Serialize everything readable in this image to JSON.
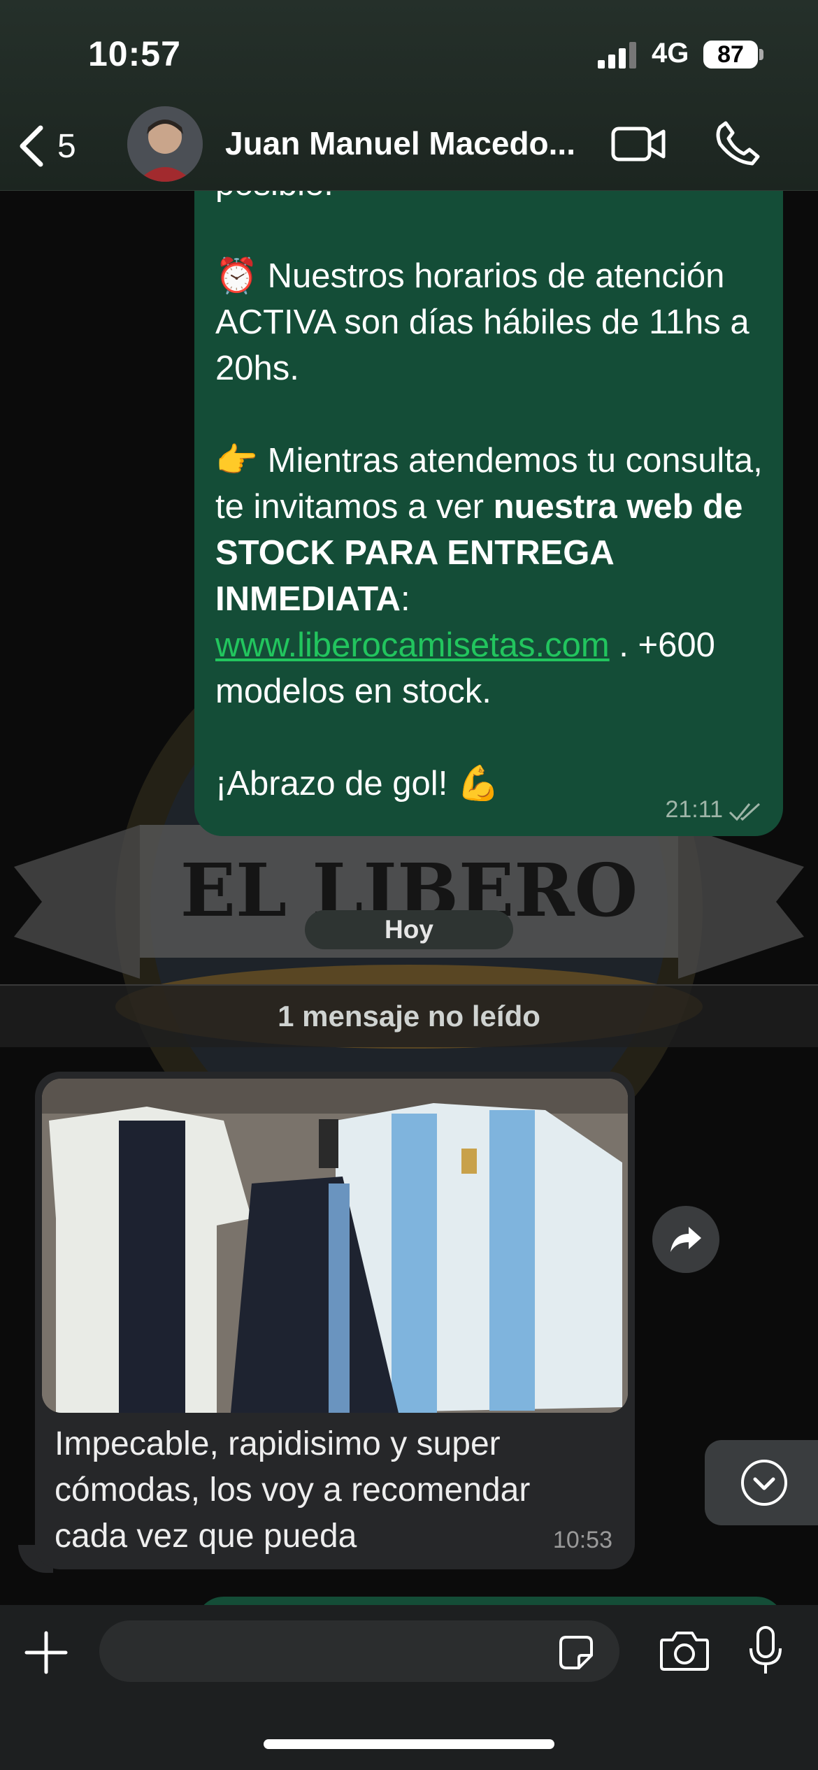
{
  "status_bar": {
    "time": "10:57",
    "network": "4G",
    "battery": "87"
  },
  "header": {
    "back_count": "5",
    "contact_name": "Juan Manuel Macedo..."
  },
  "outgoing_message": {
    "line_top": "posible.",
    "para1": "⏰ Nuestros horarios de atención ACTIVA son días hábiles de 11hs a 20hs.",
    "para2_intro": "👉 Mientras atendemos tu consulta, te invitamos a ver ",
    "para2_bold": "nuestra web de STOCK PARA ENTREGA INMEDIATA",
    "para2_colon": ":",
    "link": "www.liberocamisetas.com",
    "para2_after": " . +600 modelos en stock.",
    "closing": "¡Abrazo de gol! 💪",
    "time": "21:11"
  },
  "wallpaper_text": "EL LIBERO",
  "date_chip": "Hoy",
  "unread_banner": "1 mensaje no leído",
  "incoming_message": {
    "text": "Impecable, rapidisimo y super cómodas, los voy a recomendar cada vez que pueda",
    "time": "10:53"
  },
  "colors": {
    "outgoing_bubble": "#144d37",
    "incoming_bubble": "#262729",
    "link": "#22c55e"
  }
}
